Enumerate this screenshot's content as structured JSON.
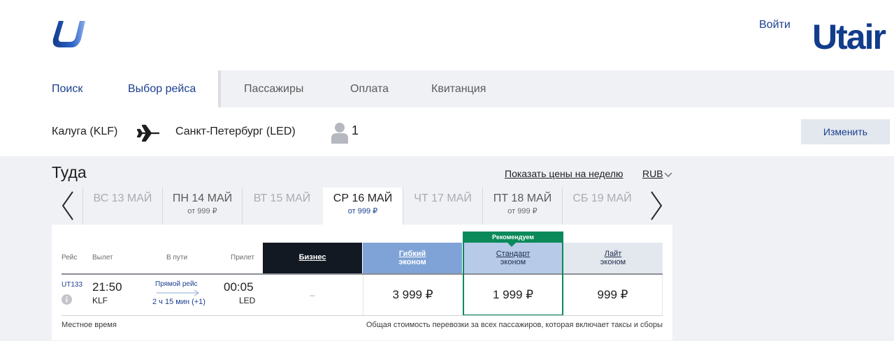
{
  "header": {
    "login_label": "Войти",
    "brand": "Utair",
    "brand_color": "#123c8c"
  },
  "steps": {
    "items": [
      {
        "label": "Поиск",
        "state": "done"
      },
      {
        "label": "Выбор рейса",
        "state": "current"
      },
      {
        "label": "Пассажиры",
        "state": "todo"
      },
      {
        "label": "Оплата",
        "state": "todo"
      },
      {
        "label": "Квитанция",
        "state": "todo"
      }
    ]
  },
  "route": {
    "from": "Калуга (KLF)",
    "to": "Санкт-Петербург (LED)",
    "passengers": "1",
    "change_label": "Изменить",
    "icons": [
      "plane-icon",
      "person-icon"
    ]
  },
  "outbound": {
    "title": "Туда",
    "week_prices_link": "Показать цены на неделю",
    "currency": "RUB",
    "dates": [
      {
        "label": "ВС 13 МАЙ",
        "price": "",
        "state": "inactive"
      },
      {
        "label": "ПН 14 МАЙ",
        "price": "от 999 ₽",
        "state": "available"
      },
      {
        "label": "ВТ 15 МАЙ",
        "price": "",
        "state": "inactive"
      },
      {
        "label": "СР 16 МАЙ",
        "price": "от 999 ₽",
        "state": "active"
      },
      {
        "label": "ЧТ 17 МАЙ",
        "price": "",
        "state": "inactive"
      },
      {
        "label": "ПТ 18 МАЙ",
        "price": "от 999 ₽",
        "state": "available"
      },
      {
        "label": "СБ 19 МАЙ",
        "price": "",
        "state": "inactive"
      }
    ]
  },
  "table": {
    "columns": {
      "flight": "Рейс",
      "departure": "Вылет",
      "duration": "В пути",
      "arrival": "Прилет"
    },
    "recommended_label": "Рекомендуем",
    "fares": [
      {
        "name": "Бизнес",
        "sub": "",
        "color": "#131923"
      },
      {
        "name": "Гибкий",
        "sub": "эконом",
        "color": "#7fa3d6"
      },
      {
        "name": "Стандарт",
        "sub": "эконом",
        "color": "#b7cbe8"
      },
      {
        "name": "Лайт",
        "sub": "эконом",
        "color": "#e3e7ee"
      }
    ],
    "row": {
      "flight_no": "UT133",
      "dep_time": "21:50",
      "dep_code": "KLF",
      "direct_label": "Прямой рейс",
      "duration": "2 ч 15 мин (+1)",
      "arr_time": "00:05",
      "arr_code": "LED",
      "prices": [
        "–",
        "3 999 ₽",
        "1 999 ₽",
        "999 ₽"
      ]
    },
    "footer_left": "Местное время",
    "footer_right": "Общая стоимость перевозки за всех пассажиров, которая включает таксы и сборы"
  },
  "colors": {
    "accent": "#1b3f8f",
    "recommended": "#0a8a5b",
    "background": "#f0f1f5"
  }
}
